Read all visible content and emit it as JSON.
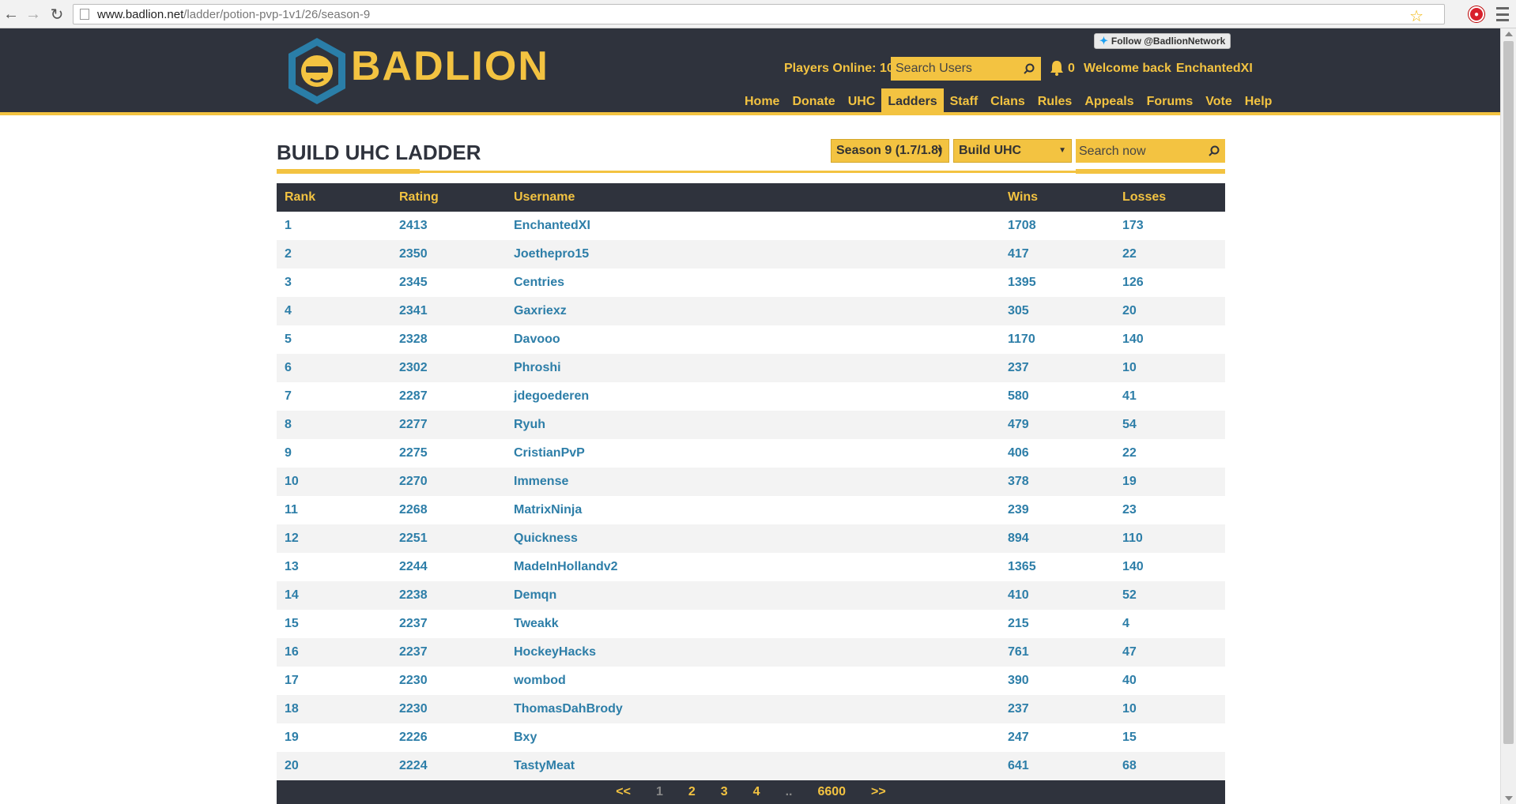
{
  "browser": {
    "url_domain": "www.badlion.net",
    "url_path": "/ladder/potion-pvp-1v1/26/season-9"
  },
  "header": {
    "logo_text": "BADLION",
    "follow_label": "Follow @BadlionNetwork",
    "players_online_label": "Players Online: 1027",
    "search_users_placeholder": "Search Users",
    "notification_count": "0",
    "welcome_label": "Welcome back",
    "username": "EnchantedXI",
    "nav": [
      {
        "label": "Home",
        "active": false
      },
      {
        "label": "Donate",
        "active": false
      },
      {
        "label": "UHC",
        "active": false
      },
      {
        "label": "Ladders",
        "active": true
      },
      {
        "label": "Staff",
        "active": false
      },
      {
        "label": "Clans",
        "active": false
      },
      {
        "label": "Rules",
        "active": false
      },
      {
        "label": "Appeals",
        "active": false
      },
      {
        "label": "Forums",
        "active": false
      },
      {
        "label": "Vote",
        "active": false
      },
      {
        "label": "Help",
        "active": false
      }
    ]
  },
  "ladder": {
    "title": "BUILD UHC LADDER",
    "season_select": "Season 9 (1.7/1.8)",
    "ladder_select": "Build UHC",
    "search_placeholder": "Search now",
    "columns": [
      "Rank",
      "Rating",
      "Username",
      "Wins",
      "Losses"
    ],
    "rows": [
      [
        "1",
        "2413",
        "EnchantedXI",
        "1708",
        "173"
      ],
      [
        "2",
        "2350",
        "Joethepro15",
        "417",
        "22"
      ],
      [
        "3",
        "2345",
        "Centries",
        "1395",
        "126"
      ],
      [
        "4",
        "2341",
        "Gaxriexz",
        "305",
        "20"
      ],
      [
        "5",
        "2328",
        "Davooo",
        "1170",
        "140"
      ],
      [
        "6",
        "2302",
        "Phroshi",
        "237",
        "10"
      ],
      [
        "7",
        "2287",
        "jdegoederen",
        "580",
        "41"
      ],
      [
        "8",
        "2277",
        "Ryuh",
        "479",
        "54"
      ],
      [
        "9",
        "2275",
        "CristianPvP",
        "406",
        "22"
      ],
      [
        "10",
        "2270",
        "Immense",
        "378",
        "19"
      ],
      [
        "11",
        "2268",
        "MatrixNinja",
        "239",
        "23"
      ],
      [
        "12",
        "2251",
        "Quickness",
        "894",
        "110"
      ],
      [
        "13",
        "2244",
        "MadeInHollandv2",
        "1365",
        "140"
      ],
      [
        "14",
        "2238",
        "Demqn",
        "410",
        "52"
      ],
      [
        "15",
        "2237",
        "Tweakk",
        "215",
        "4"
      ],
      [
        "16",
        "2237",
        "HockeyHacks",
        "761",
        "47"
      ],
      [
        "17",
        "2230",
        "wombod",
        "390",
        "40"
      ],
      [
        "18",
        "2230",
        "ThomasDahBrody",
        "237",
        "10"
      ],
      [
        "19",
        "2226",
        "Bxy",
        "247",
        "15"
      ],
      [
        "20",
        "2224",
        "TastyMeat",
        "641",
        "68"
      ]
    ]
  },
  "pagination": {
    "prev": "<<",
    "pages": [
      "1",
      "2",
      "3",
      "4"
    ],
    "current": "1",
    "ellipsis": "..",
    "last": "6600",
    "next": ">>"
  },
  "colors": {
    "header_bg": "#2f333d",
    "accent": "#f3c341",
    "link": "#2d7ea8"
  }
}
